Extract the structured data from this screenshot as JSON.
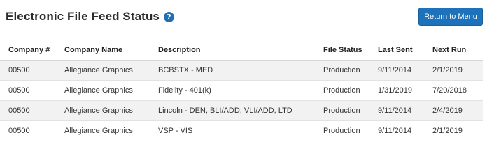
{
  "header": {
    "title": "Electronic File Feed Status",
    "help_icon_glyph": "?",
    "return_button_label": "Return to Menu"
  },
  "table": {
    "columns": {
      "company_no": "Company #",
      "company_name": "Company Name",
      "description": "Description",
      "file_status": "File Status",
      "last_sent": "Last Sent",
      "next_run": "Next Run"
    },
    "rows": [
      {
        "company_no": "00500",
        "company_name": "Allegiance Graphics",
        "description": "BCBSTX - MED",
        "file_status": "Production",
        "last_sent": "9/11/2014",
        "next_run": "2/1/2019"
      },
      {
        "company_no": "00500",
        "company_name": "Allegiance Graphics",
        "description": "Fidelity - 401(k)",
        "file_status": "Production",
        "last_sent": "1/31/2019",
        "next_run": "7/20/2018"
      },
      {
        "company_no": "00500",
        "company_name": "Allegiance Graphics",
        "description": "Lincoln - DEN, BLI/ADD, VLI/ADD, LTD",
        "file_status": "Production",
        "last_sent": "9/11/2014",
        "next_run": "2/4/2019"
      },
      {
        "company_no": "00500",
        "company_name": "Allegiance Graphics",
        "description": "VSP - VIS",
        "file_status": "Production",
        "last_sent": "9/11/2014",
        "next_run": "2/1/2019"
      }
    ]
  },
  "colors": {
    "accent": "#1d72bb",
    "help_icon": "#1f6fb5",
    "row_stripe": "#f2f2f2"
  }
}
